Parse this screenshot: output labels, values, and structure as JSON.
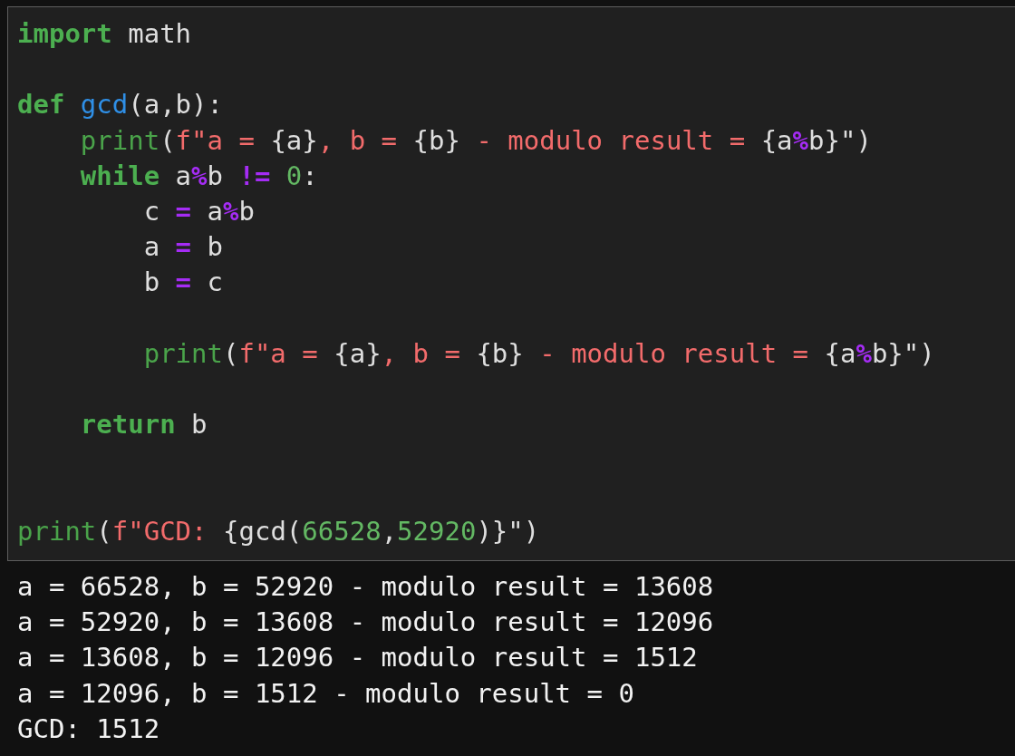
{
  "editor": {
    "lines": [
      {
        "kind": "code",
        "tokens": [
          {
            "kind": "keyword",
            "text": "import"
          },
          {
            "kind": "plain",
            "text": " math"
          }
        ]
      },
      {
        "kind": "blank"
      },
      {
        "kind": "code",
        "tokens": [
          {
            "kind": "keyword",
            "text": "def "
          },
          {
            "kind": "function",
            "text": "gcd"
          },
          {
            "kind": "plain",
            "text": "(a,b):"
          }
        ]
      },
      {
        "kind": "code",
        "tokens": [
          {
            "kind": "builtin",
            "text": "    print"
          },
          {
            "kind": "plain",
            "text": "("
          },
          {
            "kind": "string",
            "text": "f\"a = "
          },
          {
            "kind": "plain",
            "text": "{a}"
          },
          {
            "kind": "string",
            "text": ", b = "
          },
          {
            "kind": "plain",
            "text": "{b}"
          },
          {
            "kind": "string",
            "text": " - modulo result = "
          },
          {
            "kind": "plain",
            "text": "{a"
          },
          {
            "kind": "operator",
            "text": "%"
          },
          {
            "kind": "plain",
            "text": "b}\")"
          }
        ]
      },
      {
        "kind": "code",
        "tokens": [
          {
            "kind": "keyword",
            "text": "    while"
          },
          {
            "kind": "plain",
            "text": " a"
          },
          {
            "kind": "operator",
            "text": "%"
          },
          {
            "kind": "plain",
            "text": "b "
          },
          {
            "kind": "operator",
            "text": "!="
          },
          {
            "kind": "number",
            "text": " 0"
          },
          {
            "kind": "plain",
            "text": ":"
          }
        ]
      },
      {
        "kind": "code",
        "tokens": [
          {
            "kind": "plain",
            "text": "        c "
          },
          {
            "kind": "operator",
            "text": "="
          },
          {
            "kind": "plain",
            "text": " a"
          },
          {
            "kind": "operator",
            "text": "%"
          },
          {
            "kind": "plain",
            "text": "b"
          }
        ]
      },
      {
        "kind": "code",
        "tokens": [
          {
            "kind": "plain",
            "text": "        a "
          },
          {
            "kind": "operator",
            "text": "="
          },
          {
            "kind": "plain",
            "text": " b"
          }
        ]
      },
      {
        "kind": "code",
        "tokens": [
          {
            "kind": "plain",
            "text": "        b "
          },
          {
            "kind": "operator",
            "text": "="
          },
          {
            "kind": "plain",
            "text": " c"
          }
        ]
      },
      {
        "kind": "blank"
      },
      {
        "kind": "code",
        "tokens": [
          {
            "kind": "builtin",
            "text": "        print"
          },
          {
            "kind": "plain",
            "text": "("
          },
          {
            "kind": "string",
            "text": "f\"a = "
          },
          {
            "kind": "plain",
            "text": "{a}"
          },
          {
            "kind": "string",
            "text": ", b = "
          },
          {
            "kind": "plain",
            "text": "{b}"
          },
          {
            "kind": "string",
            "text": " - modulo result = "
          },
          {
            "kind": "plain",
            "text": "{a"
          },
          {
            "kind": "operator",
            "text": "%"
          },
          {
            "kind": "plain",
            "text": "b}\")"
          }
        ]
      },
      {
        "kind": "blank"
      },
      {
        "kind": "code",
        "tokens": [
          {
            "kind": "keyword",
            "text": "    return"
          },
          {
            "kind": "plain",
            "text": " b"
          }
        ]
      },
      {
        "kind": "blank"
      },
      {
        "kind": "blank"
      },
      {
        "kind": "code",
        "tokens": [
          {
            "kind": "builtin",
            "text": "print"
          },
          {
            "kind": "plain",
            "text": "("
          },
          {
            "kind": "string",
            "text": "f\"GCD: "
          },
          {
            "kind": "plain",
            "text": "{gcd("
          },
          {
            "kind": "number",
            "text": "66528"
          },
          {
            "kind": "plain",
            "text": ","
          },
          {
            "kind": "number",
            "text": "52920"
          },
          {
            "kind": "plain",
            "text": ")}\")"
          }
        ]
      }
    ]
  },
  "output": {
    "lines": [
      "a = 66528, b = 52920 - modulo result = 13608",
      "a = 52920, b = 13608 - modulo result = 12096",
      "a = 13608, b = 12096 - modulo result = 1512",
      "a = 12096, b = 1512 - modulo result = 0",
      "GCD: 1512"
    ]
  }
}
